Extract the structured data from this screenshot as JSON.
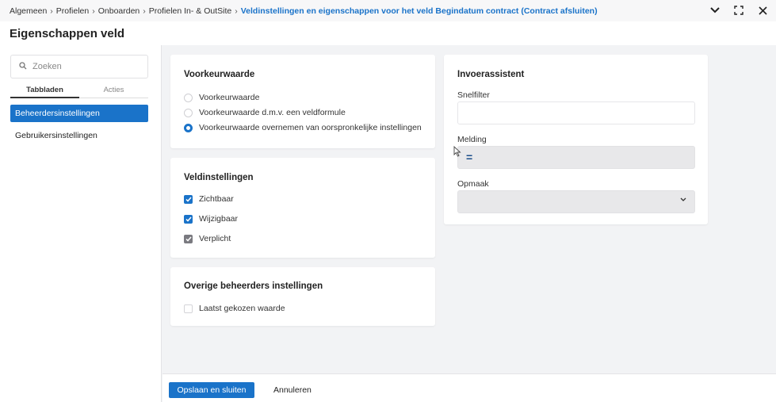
{
  "breadcrumb": {
    "items": [
      "Algemeen",
      "Profielen",
      "Onboarden",
      "Profielen In- & OutSite"
    ],
    "current": "Veldinstellingen en eigenschappen voor het veld Begindatum contract (Contract afsluiten)",
    "separator": "›"
  },
  "window_controls": {
    "collapse": "⌄",
    "expand": "⛶",
    "close": "✕"
  },
  "page_title": "Eigenschappen veld",
  "sidebar": {
    "search_placeholder": "Zoeken",
    "tabs": [
      {
        "label": "Tabbladen",
        "active": true
      },
      {
        "label": "Acties",
        "active": false
      }
    ],
    "items": [
      {
        "label": "Beheerdersinstellingen",
        "selected": true
      },
      {
        "label": "Gebruikersinstellingen",
        "selected": false
      }
    ]
  },
  "voorkeurwaarde": {
    "title": "Voorkeurwaarde",
    "options": [
      {
        "label": "Voorkeurwaarde",
        "selected": false
      },
      {
        "label": "Voorkeurwaarde d.m.v. een veldformule",
        "selected": false
      },
      {
        "label": "Voorkeurwaarde overnemen van oorspronkelijke instellingen",
        "selected": true
      }
    ]
  },
  "veldinstellingen": {
    "title": "Veldinstellingen",
    "items": [
      {
        "label": "Zichtbaar",
        "checked": true
      },
      {
        "label": "Wijzigbaar",
        "checked": true
      },
      {
        "label": "Verplicht",
        "checked": true
      }
    ]
  },
  "overige": {
    "title": "Overige beheerders instellingen",
    "items": [
      {
        "label": "Laatst gekozen waarde",
        "checked": false
      }
    ]
  },
  "invoerassistent": {
    "title": "Invoerassistent",
    "snelfilter_label": "Snelfilter",
    "snelfilter_value": "",
    "melding_label": "Melding",
    "melding_value": "=",
    "opmaak_label": "Opmaak",
    "opmaak_value": ""
  },
  "footer": {
    "save_label": "Opslaan en sluiten",
    "cancel_label": "Annuleren"
  },
  "colors": {
    "accent": "#1a73c9",
    "disabled_check": "#7a7a80"
  }
}
